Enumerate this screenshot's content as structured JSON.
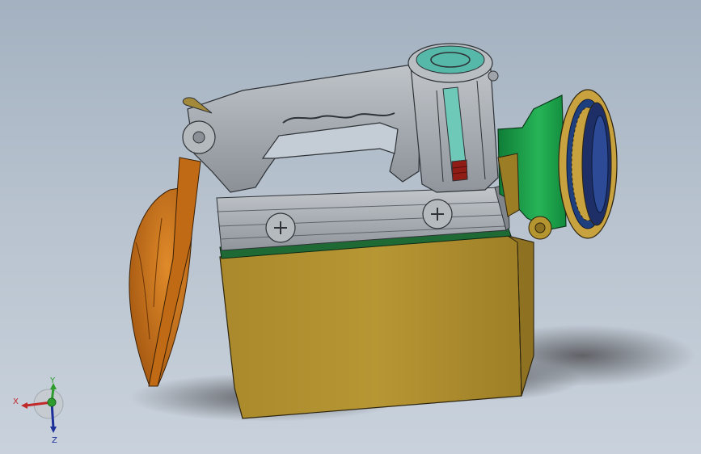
{
  "viewport": {
    "model": "portable-searchlight-assembly",
    "triad": {
      "x_label": "X",
      "y_label": "Y",
      "z_label": "Z",
      "x_color": "#c0282a",
      "y_color": "#2e9d2e",
      "z_color": "#1d2f9a"
    }
  },
  "colors": {
    "background_top": "#a3b1c0",
    "background_bottom": "#c9d2dc",
    "body": "#b29130",
    "body_shadow": "#6c6c70",
    "band": "#1f6a34",
    "frame": "#a9aeb3",
    "handle": "#9ea4aa",
    "reflector": "#c96d12",
    "lamp_head": "#1fa04c",
    "lens_ring": "#c8a23e",
    "lens_ring_inner": "#1e3f7e",
    "gauge_glass": "#6fc9b8",
    "cap_ring": "#56b8a8"
  }
}
